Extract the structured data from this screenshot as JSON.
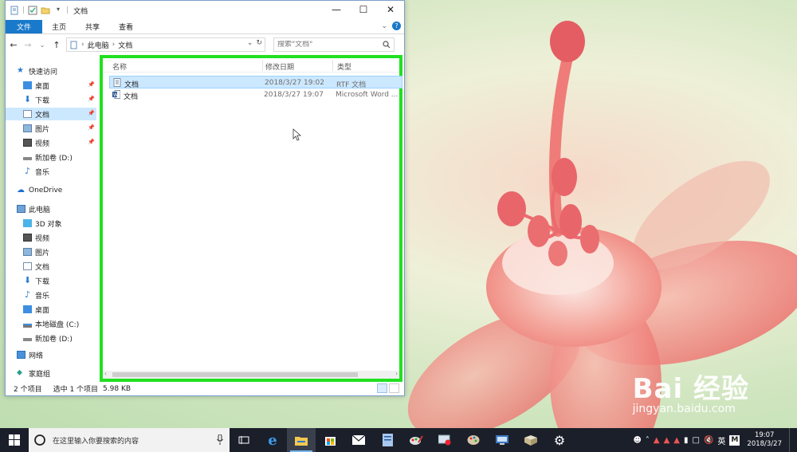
{
  "window": {
    "title": "文档",
    "ribbon_tabs": [
      "文件",
      "主页",
      "共享",
      "查看"
    ],
    "breadcrumb": [
      "此电脑",
      "文档"
    ],
    "search_placeholder": "搜索\"文档\"",
    "columns": [
      "名称",
      "修改日期",
      "类型"
    ],
    "files": [
      {
        "name": "文档",
        "date": "2018/3/27 19:02",
        "type": "RTF 文档",
        "icon": "rtf-file-icon",
        "selected": true
      },
      {
        "name": "文档",
        "date": "2018/3/27 19:07",
        "type": "Microsoft Word ...",
        "icon": "word-file-icon",
        "selected": false
      }
    ],
    "status": {
      "count": "2 个项目",
      "selection": "选中 1 个项目",
      "size": "5.98 KB"
    }
  },
  "sidebar": {
    "quick_access": "快速访问",
    "quick_items": [
      "桌面",
      "下载",
      "文档",
      "图片",
      "视频",
      "新加卷 (D:)",
      "音乐"
    ],
    "onedrive": "OneDrive",
    "this_pc": "此电脑",
    "pc_items": [
      "3D 对象",
      "视频",
      "图片",
      "文档",
      "下载",
      "音乐",
      "桌面",
      "本地磁盘 (C:)",
      "新加卷 (D:)"
    ],
    "network": "网络",
    "homegroup": "家庭组"
  },
  "taskbar": {
    "search_text": "在这里输入你要搜索的内容",
    "lang": "英",
    "ime": "M",
    "time": "19:07",
    "date": "2018/3/27"
  },
  "watermark": {
    "main": "Bai 经验",
    "sub": "jingyan.baidu.com"
  },
  "colors": {
    "accent": "#1979ca",
    "highlight": "#21e021",
    "selection": "#cce8ff",
    "taskbar": "#1b1f2a"
  }
}
